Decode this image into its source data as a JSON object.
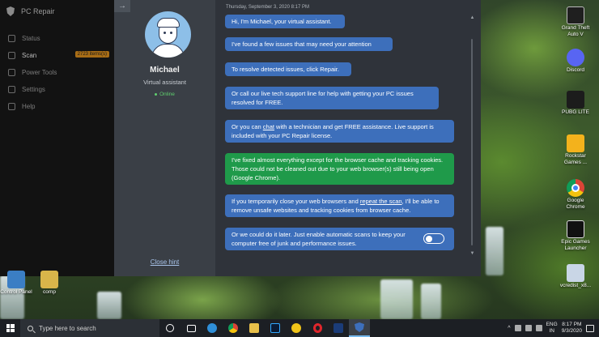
{
  "app": {
    "title": "PC Repair",
    "nav": [
      {
        "label": "Status",
        "icon": "status-icon"
      },
      {
        "label": "Scan",
        "icon": "scan-icon",
        "badge": "2723 items(s)"
      },
      {
        "label": "Power Tools",
        "icon": "tools-icon"
      },
      {
        "label": "Settings",
        "icon": "gear-icon"
      },
      {
        "label": "Help",
        "icon": "help-icon"
      }
    ]
  },
  "agent": {
    "back_symbol": "→",
    "name": "Michael",
    "role": "Virtual assistant",
    "status": "Online",
    "close_hint": "Close hint"
  },
  "chat": {
    "timestamp": "Thursday, September 3, 2020 8:17 PM",
    "messages": [
      {
        "text": "Hi, I'm Michael, your virtual assistant.",
        "color": "blue"
      },
      {
        "text": "I've found a few issues that may need your attention",
        "color": "blue"
      },
      {
        "text": "To resolve detected issues, click Repair.",
        "color": "blue"
      },
      {
        "text": "Or call our live tech support line for help with getting your PC issues resolved for FREE.",
        "color": "blue"
      },
      {
        "pre": "Or you can ",
        "link": "chat",
        "post": " with a technician and get FREE assistance. Live support is included with your PC Repair license.",
        "color": "blue"
      },
      {
        "text": "I've fixed almost everything except for the browser cache and tracking cookies. Those could not be cleaned out due to your web browser(s) still being open (Google Chrome).",
        "color": "green"
      },
      {
        "pre": "If you temporarily close your web browsers and ",
        "link": "repeat the scan",
        "post": ", I'll be able to remove unsafe websites and tracking cookies from browser cache.",
        "color": "blue"
      },
      {
        "text": "Or we could do it later. Just enable automatic scans to keep your computer free of junk and performance issues.",
        "color": "blue",
        "toggle": "off"
      }
    ]
  },
  "desktop_icons": [
    {
      "label": "Grand Theft Auto V",
      "icon": "gta-icon"
    },
    {
      "label": "Discord",
      "icon": "discord-icon"
    },
    {
      "label": "PUBG LITE",
      "icon": "pubg-icon"
    },
    {
      "label": "Rockstar Games ...",
      "icon": "rockstar-icon"
    },
    {
      "label": "Google Chrome",
      "icon": "chrome-icon"
    },
    {
      "label": "Epic Games Launcher",
      "icon": "epic-icon"
    },
    {
      "label": "vcredist_x8...",
      "icon": "installer-icon"
    },
    {
      "label": "Control Panel",
      "icon": "control-panel-icon"
    },
    {
      "label": "comp",
      "icon": "folder-icon"
    }
  ],
  "taskbar": {
    "search_placeholder": "Type here to search",
    "lang_top": "ENG",
    "lang_bottom": "IN",
    "time": "8:17 PM",
    "date": "9/3/2020"
  },
  "colors": {
    "bubble_blue": "#3d6fbb",
    "bubble_green": "#1f9a4a",
    "online": "#5fd06e"
  }
}
